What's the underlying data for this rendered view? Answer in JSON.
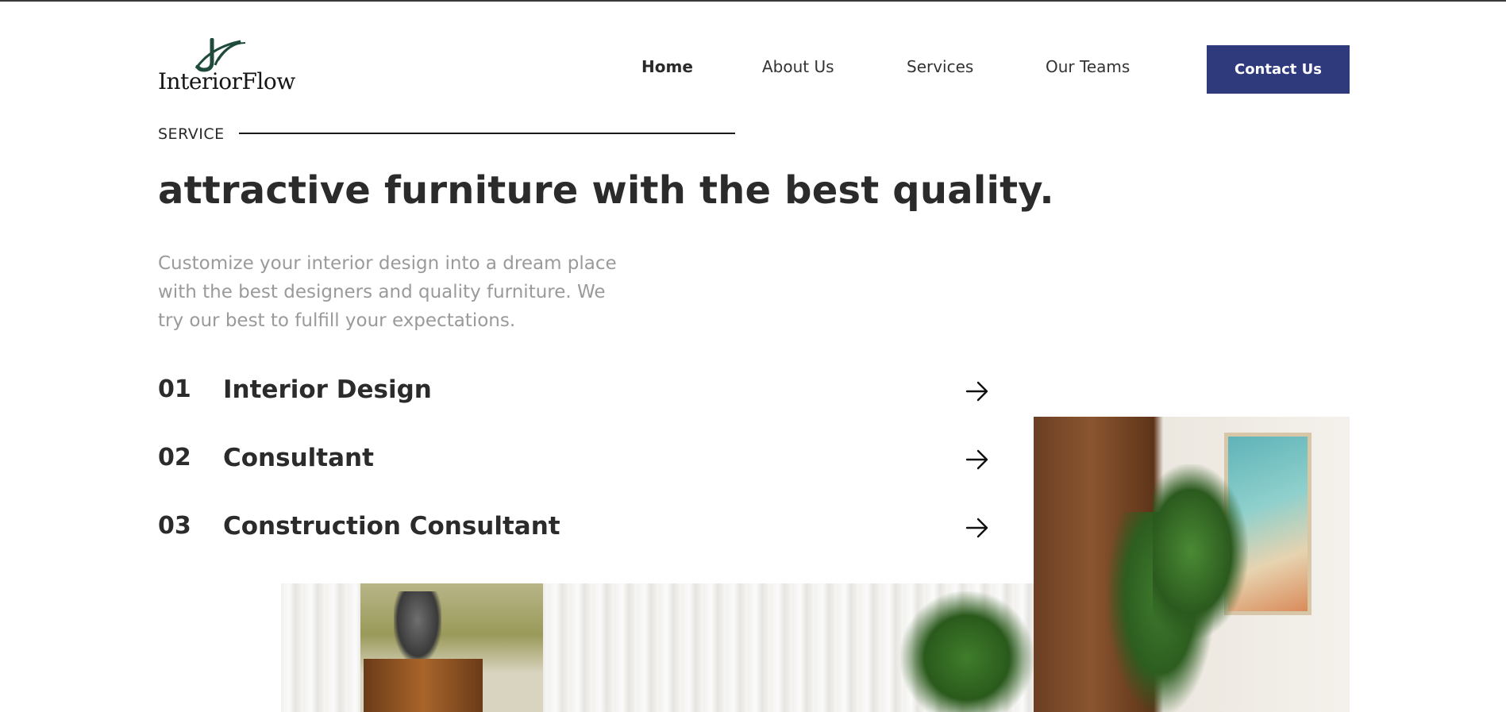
{
  "brand": {
    "name": "InteriorFlow",
    "accent_color": "#2f3a7d",
    "logo_color": "#1f4a3c"
  },
  "nav": {
    "items": [
      {
        "label": "Home",
        "active": true
      },
      {
        "label": "About Us",
        "active": false
      },
      {
        "label": "Services",
        "active": false
      },
      {
        "label": "Our Teams",
        "active": false
      }
    ],
    "cta_label": "Contact Us"
  },
  "section": {
    "eyebrow": "SERVICE",
    "headline": "attractive furniture with the best quality.",
    "description": "Customize your interior design into a dream place with the best designers and quality furniture. We try our best to fulfill your expectations."
  },
  "services": [
    {
      "number": "01",
      "title": "Interior Design",
      "icon": "arrow-right-icon"
    },
    {
      "number": "02",
      "title": "Consultant",
      "icon": "arrow-right-icon"
    },
    {
      "number": "03",
      "title": "Construction Consultant",
      "icon": "arrow-right-icon"
    }
  ]
}
